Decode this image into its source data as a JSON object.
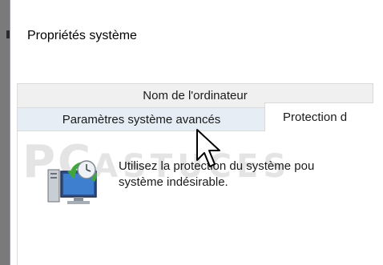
{
  "window": {
    "title": "Propriétés système"
  },
  "tabs": {
    "computer_name": "Nom de l'ordinateur",
    "advanced": "Paramètres système avancés",
    "protection": "Protection d"
  },
  "content": {
    "line1": "Utilisez la protection du système pou",
    "line2": "système indésirable."
  },
  "watermark": "PC ASTUCES",
  "icons": {
    "system_protection": "system-protection-icon",
    "cursor": "mouse-cursor-icon"
  },
  "colors": {
    "tab_inactive_bg": "#f0f0f0",
    "tab_hover_bg": "#e6edf4",
    "tab_border": "#dadada"
  }
}
